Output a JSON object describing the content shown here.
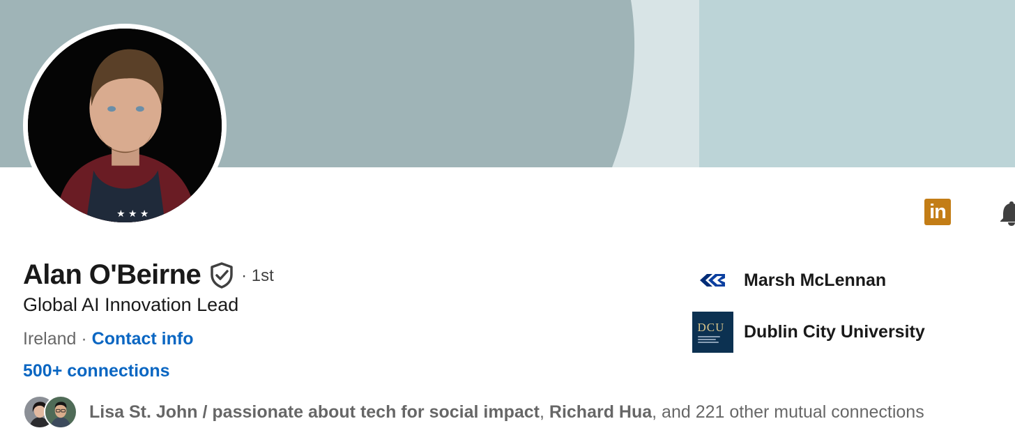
{
  "colors": {
    "banner_dark": "#9fb4b7",
    "banner_light": "#bcd4d7",
    "banner_stripe": "#d8e4e6",
    "link_blue": "#0a66c2",
    "premium_gold": "#c37d16",
    "dcu_navy": "#0c3151"
  },
  "profile": {
    "name": "Alan O'Beirne",
    "degree": "· 1st",
    "headline": "Global AI Innovation Lead",
    "location": "Ireland",
    "separator": " · ",
    "contact_info": "Contact info",
    "connections": "500+ connections",
    "verified_icon": "shield-check-icon"
  },
  "actions": {
    "premium_icon": "linkedin-premium-icon",
    "premium_label": "in",
    "bell_icon": "bell-icon"
  },
  "mutual": {
    "person_1": "Lisa St. John / passionate about tech for social impact",
    "separator_1": ", ",
    "person_2": "Richard Hua",
    "rest": ", and 221 other mutual connections"
  },
  "organizations": [
    {
      "name": "Marsh McLennan",
      "icon": "marsh-mclennan-logo-icon"
    },
    {
      "name": "Dublin City University",
      "icon": "dcu-logo-icon",
      "logo_text": "DCU"
    }
  ]
}
